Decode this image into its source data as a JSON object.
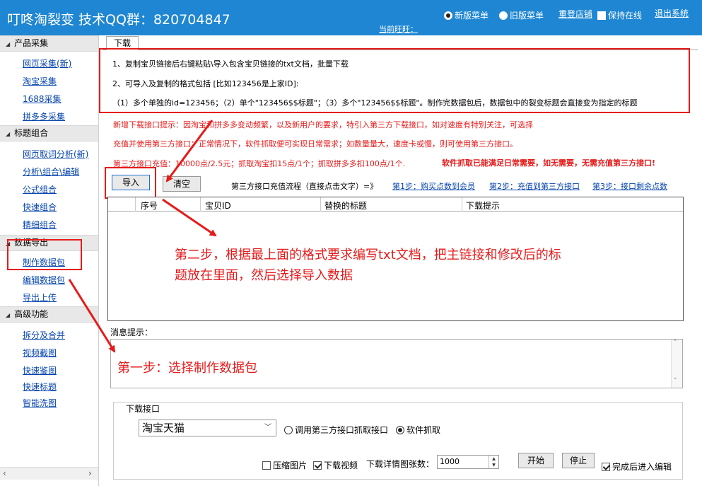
{
  "header": {
    "title": "叮咚淘裂变   技术QQ群：820704847",
    "current_wangwang": "当前旺旺：",
    "menu_new": "新版菜单",
    "menu_old": "旧版菜单",
    "relogin": "重登店铺",
    "keep_online": "保持在线",
    "exit": "退出系统"
  },
  "sidebar": {
    "groups": [
      {
        "label": "产品采集",
        "items": [
          "网页采集(新)",
          "淘宝采集",
          "1688采集",
          "拼多多采集"
        ]
      },
      {
        "label": "标题组合",
        "items": [
          "网页取词分析(新)",
          "分析\\组合\\编辑",
          "公式组合",
          "快速组合",
          "精细组合"
        ]
      },
      {
        "label": "数据导出",
        "items": [
          "制作数据包",
          "编辑数据包",
          "导出上传"
        ]
      },
      {
        "label": "高级功能",
        "items": [
          "拆分及合并",
          "视频截图",
          "快速鉴图",
          "快速标题",
          "智能洗图"
        ]
      }
    ]
  },
  "main": {
    "tab": "下载",
    "info": [
      "1、复制宝贝链接后右键粘贴\\导入包含宝贝链接的txt文档，批量下载",
      "2、可导入及复制的格式包括   [比如123456是上家ID]:",
      "（1）多个单独的id=123456；（2）单个\"123456$$标题\"；（3）多个\"123456$$标题\"。制作完数据包后，数据包中的裂变标题会直接变为指定的标题"
    ],
    "notices": [
      "新增下载接口提示：因淘宝和拼多多变动频繁，以及新用户的要求，特引入第三方下载接口，如对速度有特别关注，可选择",
      "充值并使用第三方接口；正常情况下，软件抓取便可实现日常需求；如数量量大，速度卡或慢，则可使用第三方接口。",
      "第三方接口充值：10000点/2.5元；抓取淘宝扣15点/1个；抓取拼多多扣100点/1个."
    ],
    "notice_bold": "软件抓取已能满足日常需要，如无需要，无需充值第三方接口!",
    "import_btn": "导入",
    "clear_btn": "清空",
    "flow_label": "第三方接口充值流程（直接点击文字）=》",
    "step1": "第1步：购买点数到会员",
    "step2": "第2步：充值到第三方接口",
    "step3": "第3步：接口剩余点数",
    "columns": [
      "序号",
      "宝贝ID",
      "替换的标题",
      "下载提示"
    ],
    "msg_label": "消息提示：",
    "download_group": "下载接口",
    "platform": "淘宝天猫",
    "opt_third": "调用第三方接口抓取接口",
    "opt_soft": "软件抓取",
    "compress": "压缩图片",
    "download_video": "下载视频",
    "detail_count_label": "下载详情图张数：",
    "detail_count": "1000",
    "start_btn": "开始",
    "stop_btn": "停止",
    "enter_edit": "完成后进入编辑"
  },
  "annotations": {
    "step2_line1": "第二步，根据最上面的格式要求编写txt文档，把主链接和修改后的标",
    "step2_line2": "题放在里面，然后选择导入数据",
    "step1": "第一步：选择制作数据包"
  }
}
